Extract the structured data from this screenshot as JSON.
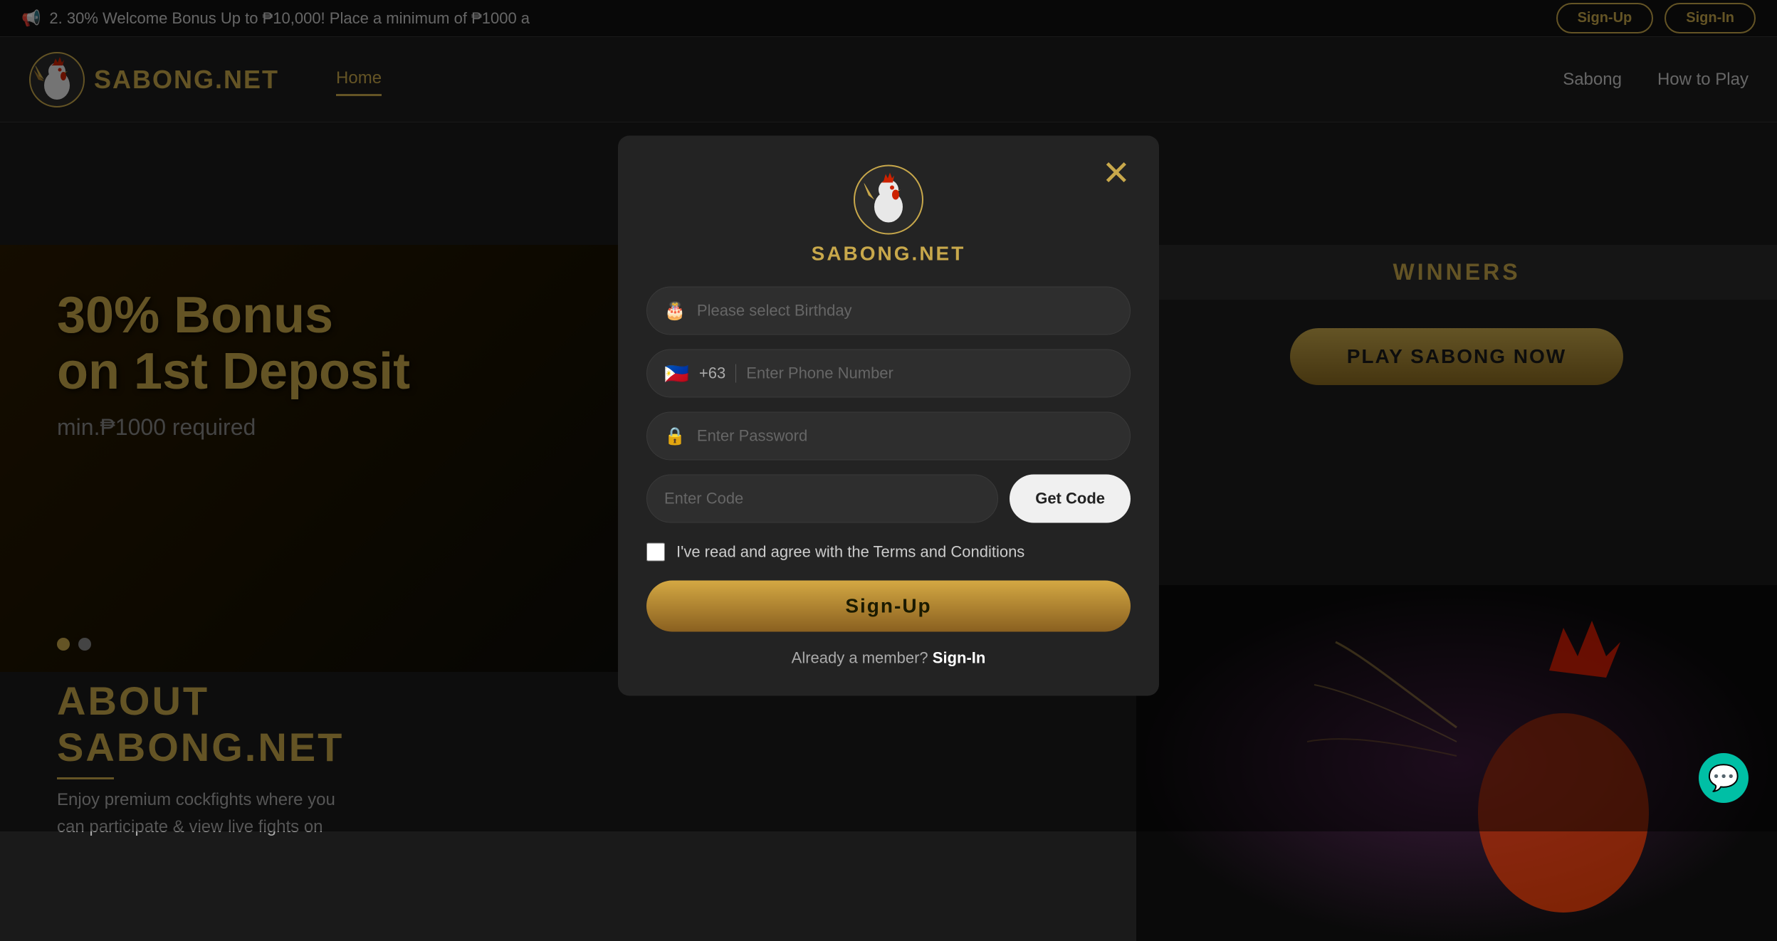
{
  "announcement": {
    "text": "2. 30% Welcome Bonus Up to ₱10,000! Place a minimum of ₱1000 a",
    "speaker_icon": "📢"
  },
  "header": {
    "logo_text": "SABONG.NET",
    "nav": {
      "home": "Home",
      "sabong": "Sabong",
      "how_to_play": "How to Play"
    },
    "auth": {
      "signup": "Sign-Up",
      "signin": "Sign-In"
    }
  },
  "banner": {
    "title_line1": "30% Bonus",
    "title_line2": "on 1st Deposit",
    "subtitle": "min.₱1000 required"
  },
  "about": {
    "title_line1": "ABOUT",
    "title_line2": "SABONG.NET",
    "description_line1": "Enjoy premium cockfights where you",
    "description_line2": "can participate & view live fights on"
  },
  "winners": {
    "title": "WINNERS",
    "play_button": "PLAY SABONG NOW"
  },
  "modal": {
    "logo_text": "SABONG.NET",
    "close_icon": "✕",
    "birthday": {
      "placeholder": "Please select Birthday",
      "icon": "🎂"
    },
    "phone": {
      "flag": "🇵🇭",
      "code": "+63",
      "placeholder": "Enter Phone Number"
    },
    "password": {
      "placeholder": "Enter Password",
      "icon": "🔒"
    },
    "code": {
      "placeholder": "Enter Code",
      "get_code_label": "Get Code"
    },
    "terms": {
      "text": "I've read and agree with the Terms and Conditions"
    },
    "signup_button": "Sign-Up",
    "already_member_text": "Already a member?",
    "signin_link": "Sign-In"
  },
  "chat": {
    "icon": "💬"
  }
}
